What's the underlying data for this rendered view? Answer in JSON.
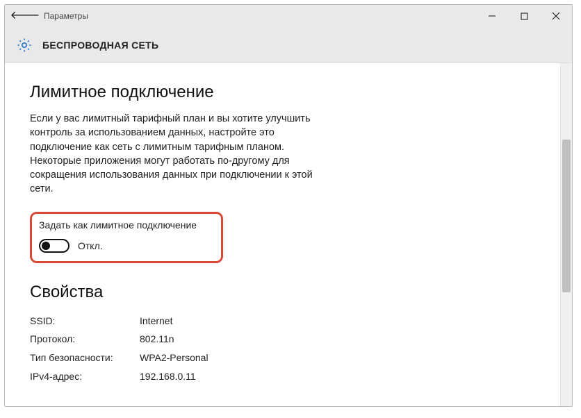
{
  "titlebar": {
    "title": "Параметры"
  },
  "header": {
    "page": "БЕСПРОВОДНАЯ СЕТЬ"
  },
  "metered": {
    "heading": "Лимитное подключение",
    "description": "Если у вас лимитный тарифный план и вы хотите улучшить контроль за использованием данных, настройте это подключение как сеть с лимитным тарифным планом. Некоторые приложения могут работать по-другому для сокращения использования данных при подключении к этой сети.",
    "toggle_label": "Задать как лимитное подключение",
    "toggle_state": "Откл."
  },
  "properties": {
    "heading": "Свойства",
    "rows": [
      {
        "key": "SSID:",
        "value": "Internet"
      },
      {
        "key": "Протокол:",
        "value": "802.11n"
      },
      {
        "key": "Тип безопасности:",
        "value": "WPA2-Personal"
      },
      {
        "key": "IPv4-адрес:",
        "value": "192.168.0.11"
      }
    ]
  }
}
